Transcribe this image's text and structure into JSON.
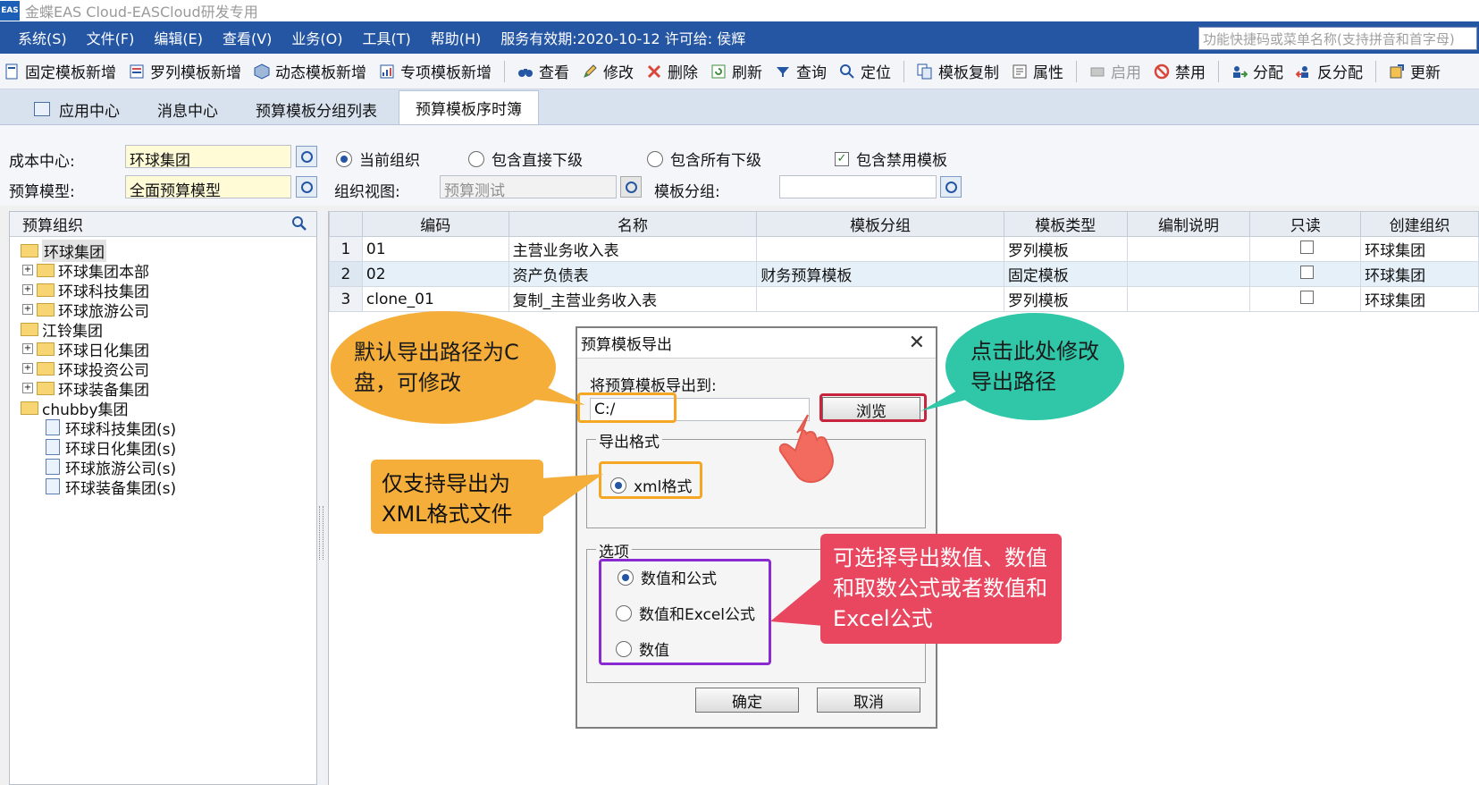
{
  "window": {
    "logo": "EAS",
    "title": "金蝶EAS Cloud-EASCloud研发专用"
  },
  "menu": {
    "items": [
      "系统(S)",
      "文件(F)",
      "编辑(E)",
      "查看(V)",
      "业务(O)",
      "工具(T)",
      "帮助(H)"
    ],
    "service_info": "服务有效期:2020-10-12 许可给: 侯辉",
    "search_placeholder": "功能快捷码或菜单名称(支持拼音和首字母)"
  },
  "toolbar": {
    "fixed_new": "固定模板新增",
    "list_new": "罗列模板新增",
    "dynamic_new": "动态模板新增",
    "special_new": "专项模板新增",
    "view": "查看",
    "modify": "修改",
    "delete": "删除",
    "refresh": "刷新",
    "query": "查询",
    "locate": "定位",
    "copy": "模板复制",
    "attr": "属性",
    "enable": "启用",
    "disable": "禁用",
    "assign": "分配",
    "unassign": "反分配",
    "update": "更新"
  },
  "tabs": [
    "应用中心",
    "消息中心",
    "预算模板分组列表",
    "预算模板序时簿"
  ],
  "filters": {
    "cost_center_label": "成本中心:",
    "cost_center_value": "环球集团",
    "budget_model_label": "预算模型:",
    "budget_model_value": "全面预算模型",
    "radio_current": "当前组织",
    "radio_direct": "包含直接下级",
    "radio_all": "包含所有下级",
    "check_disabled": "包含禁用模板",
    "org_view_label": "组织视图:",
    "org_view_value": "预算测试",
    "template_group_label": "模板分组:",
    "template_group_value": ""
  },
  "tree": {
    "title": "预算组织",
    "nodes": [
      "环球集团",
      "环球集团本部",
      "环球科技集团",
      "环球旅游公司",
      "江铃集团",
      "环球日化集团",
      "环球投资公司",
      "环球装备集团",
      "chubby集团",
      "环球科技集团(s)",
      "环球日化集团(s)",
      "环球旅游公司(s)",
      "环球装备集团(s)"
    ]
  },
  "grid": {
    "columns": [
      "编码",
      "名称",
      "模板分组",
      "模板类型",
      "编制说明",
      "只读",
      "创建组织"
    ],
    "rows": [
      {
        "n": "1",
        "code": "01",
        "name": "主营业务收入表",
        "group": "",
        "type": "罗列模板",
        "desc": "",
        "org": "环球集团"
      },
      {
        "n": "2",
        "code": "02",
        "name": "资产负债表",
        "group": "财务预算模板",
        "type": "固定模板",
        "desc": "",
        "org": "环球集团"
      },
      {
        "n": "3",
        "code": "clone_01",
        "name": "复制_主营业务收入表",
        "group": "",
        "type": "罗列模板",
        "desc": "",
        "org": "环球集团"
      }
    ]
  },
  "dialog": {
    "title": "预算模板导出",
    "export_to_label": "将预算模板导出到:",
    "path_value": "C:/",
    "browse": "浏览",
    "format_group": "导出格式",
    "format_xml": "xml格式",
    "options_group": "选项",
    "opt_value_formula": "数值和公式",
    "opt_value_excel": "数值和Excel公式",
    "opt_value": "数值",
    "ok": "确定",
    "cancel": "取消"
  },
  "annotations": {
    "path_note": "默认导出路径为C盘，可修改",
    "browse_note": "点击此处修改导出路径",
    "xml_note": "仅支持导出为XML格式文件",
    "options_note": "可选择导出数值、数值和取数公式或者数值和Excel公式"
  },
  "colors": {
    "menubar": "#2456a4",
    "orange_callout": "#f5ae3a",
    "teal_callout": "#2fc7a8",
    "red_callout": "#e8475f",
    "purple_box": "#8a2bd1",
    "red_box": "#c9243d",
    "orange_box": "#f5a623"
  }
}
